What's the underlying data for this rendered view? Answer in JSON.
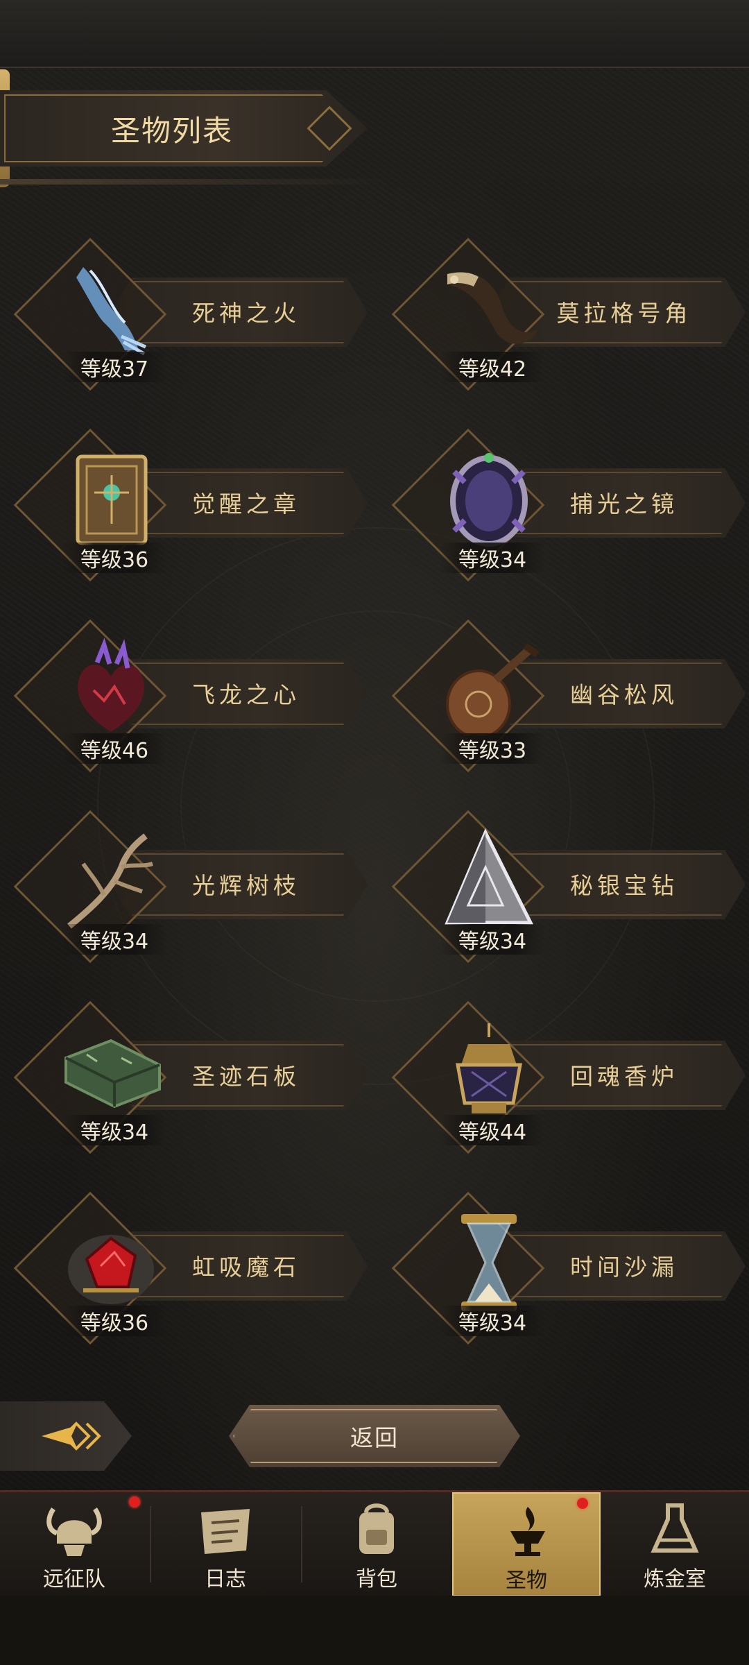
{
  "page": {
    "title": "圣物列表"
  },
  "relics": [
    {
      "name": "死神之火",
      "level": "等级37",
      "icon": "spectral-hand-icon"
    },
    {
      "name": "莫拉格号角",
      "level": "等级42",
      "icon": "horn-icon"
    },
    {
      "name": "觉醒之章",
      "level": "等级36",
      "icon": "tome-icon"
    },
    {
      "name": "捕光之镜",
      "level": "等级34",
      "icon": "mirror-icon"
    },
    {
      "name": "飞龙之心",
      "level": "等级46",
      "icon": "dragon-heart-icon"
    },
    {
      "name": "幽谷松风",
      "level": "等级33",
      "icon": "lute-icon"
    },
    {
      "name": "光辉树枝",
      "level": "等级34",
      "icon": "branch-icon"
    },
    {
      "name": "秘银宝钻",
      "level": "等级34",
      "icon": "pyramid-gem-icon"
    },
    {
      "name": "圣迹石板",
      "level": "等级34",
      "icon": "stone-tablet-icon"
    },
    {
      "name": "回魂香炉",
      "level": "等级44",
      "icon": "censer-icon"
    },
    {
      "name": "虹吸魔石",
      "level": "等级36",
      "icon": "ruby-stone-icon"
    },
    {
      "name": "时间沙漏",
      "level": "等级34",
      "icon": "hourglass-icon"
    }
  ],
  "controls": {
    "back_label": "返回"
  },
  "nav": {
    "items": [
      {
        "label": "远征队",
        "icon": "viking-helmet-icon",
        "badge": true
      },
      {
        "label": "日志",
        "icon": "scroll-icon",
        "badge": false
      },
      {
        "label": "背包",
        "icon": "backpack-icon",
        "badge": false
      },
      {
        "label": "圣物",
        "icon": "brazier-icon",
        "badge": true,
        "active": true
      },
      {
        "label": "炼金室",
        "icon": "alchemy-icon",
        "badge": false
      }
    ]
  },
  "colors": {
    "accent_gold": "#c6a45a",
    "text_gold": "#e8cf98",
    "badge_red": "#e0201c"
  }
}
